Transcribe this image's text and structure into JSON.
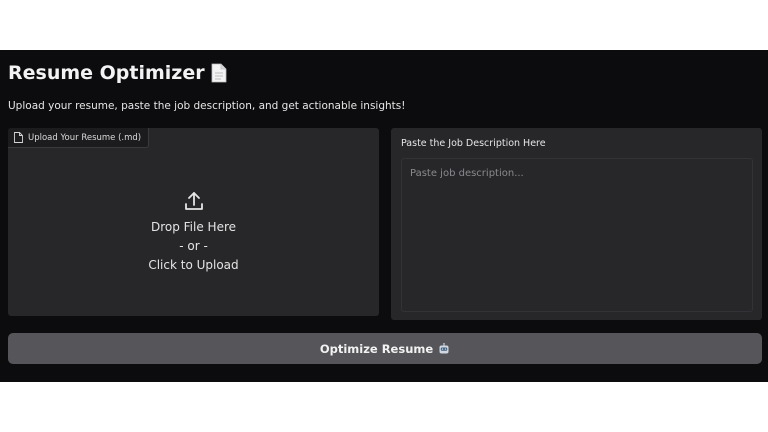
{
  "header": {
    "title": "Resume Optimizer",
    "title_icon": "page-document-icon",
    "subtitle": "Upload your resume, paste the job description, and get actionable insights!"
  },
  "upload": {
    "tab_label": "Upload Your Resume (.md)",
    "tab_icon": "file-icon",
    "upload_icon": "upload-arrow-icon",
    "drop_text": "Drop File Here",
    "or_text": "- or -",
    "click_text": "Click to Upload"
  },
  "job": {
    "label": "Paste the Job Description Here",
    "placeholder": "Paste job description...",
    "value": ""
  },
  "action": {
    "optimize_label": "Optimize Resume",
    "optimize_icon": "robot-icon"
  },
  "colors": {
    "app_bg": "#0c0c0e",
    "panel_bg": "#27272a",
    "button_bg": "#56565a",
    "text": "#e6e6e6"
  }
}
